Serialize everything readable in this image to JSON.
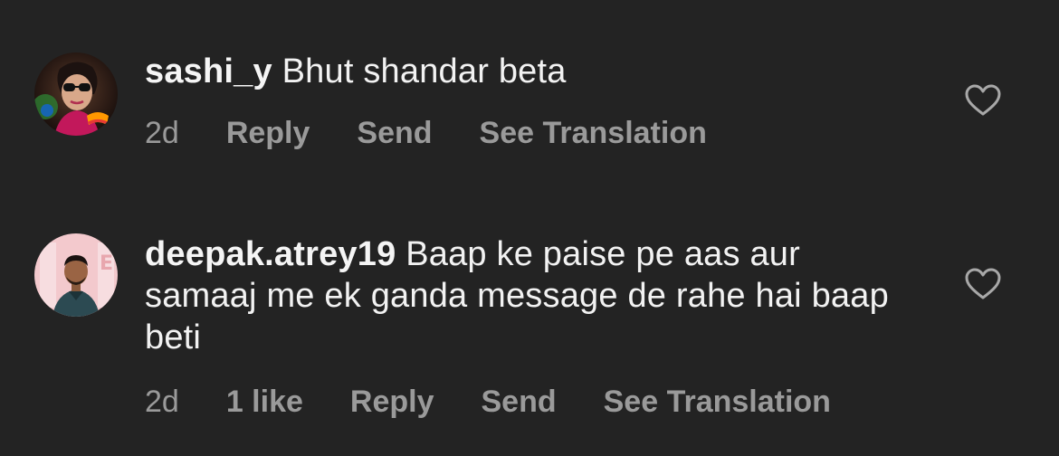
{
  "comments": [
    {
      "username": "sashi_y",
      "text": "Bhut shandar beta",
      "age": "2d",
      "likes": "",
      "reply_label": "Reply",
      "send_label": "Send",
      "translate_label": "See Translation"
    },
    {
      "username": "deepak.atrey19",
      "text": "Baap ke paise pe aas aur samaaj me ek ganda message de rahe hai baap beti",
      "age": "2d",
      "likes": "1 like",
      "reply_label": "Reply",
      "send_label": "Send",
      "translate_label": "See Translation"
    }
  ],
  "colors": {
    "background": "#232323",
    "text": "#f2f2f2",
    "muted": "#9a9a9a"
  },
  "icons": {
    "like": "heart-outline-icon"
  }
}
